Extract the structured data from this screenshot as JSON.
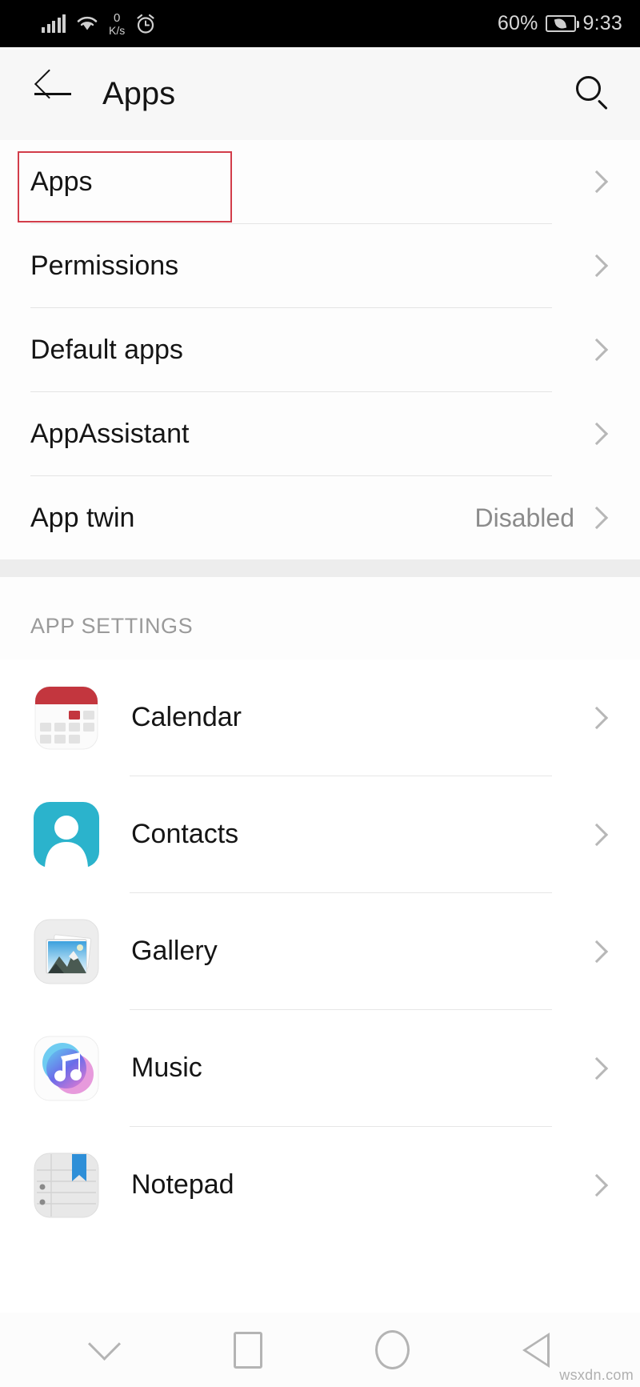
{
  "status_bar": {
    "network_speed_value": "0",
    "network_speed_unit": "K/s",
    "battery_percent": "60%",
    "time": "9:33",
    "icons": [
      "signal-bars-icon",
      "wifi-icon",
      "alarm-clock-icon",
      "battery-saver-icon"
    ]
  },
  "header": {
    "back_icon": "back-arrow-icon",
    "title": "Apps",
    "search_icon": "search-icon"
  },
  "settings_section": {
    "rows": [
      {
        "label": "Apps",
        "value": "",
        "highlighted": true
      },
      {
        "label": "Permissions",
        "value": "",
        "highlighted": false
      },
      {
        "label": "Default apps",
        "value": "",
        "highlighted": false
      },
      {
        "label": "AppAssistant",
        "value": "",
        "highlighted": false
      },
      {
        "label": "App twin",
        "value": "Disabled",
        "highlighted": false
      }
    ]
  },
  "app_settings_section": {
    "title": "APP SETTINGS",
    "rows": [
      {
        "label": "Calendar",
        "icon": "calendar-app-icon"
      },
      {
        "label": "Contacts",
        "icon": "contacts-app-icon"
      },
      {
        "label": "Gallery",
        "icon": "gallery-app-icon"
      },
      {
        "label": "Music",
        "icon": "music-app-icon"
      },
      {
        "label": "Notepad",
        "icon": "notepad-app-icon"
      }
    ]
  },
  "nav_bar": {
    "buttons": [
      {
        "name": "hide-navbar-button",
        "icon": "chevron-down-icon"
      },
      {
        "name": "recents-button",
        "icon": "square-icon"
      },
      {
        "name": "home-button",
        "icon": "circle-icon"
      },
      {
        "name": "back-button",
        "icon": "triangle-left-icon"
      }
    ]
  },
  "watermark": "wsxdn.com",
  "colors": {
    "highlight_red": "#d23d4a",
    "calendar_red": "#c3363e",
    "contacts_cyan": "#2bb3cc",
    "notepad_blue": "#2e8fd8",
    "status_bar_black": "#000000",
    "header_gray": "#f7f7f7"
  }
}
